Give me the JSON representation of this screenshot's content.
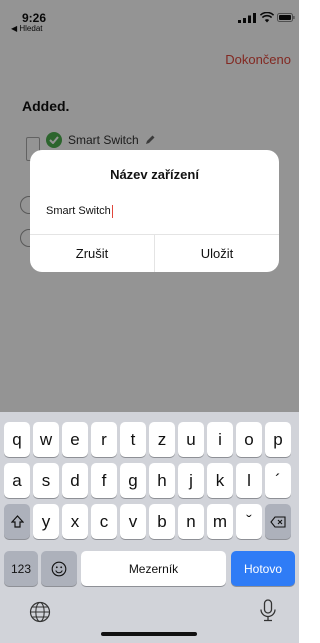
{
  "status_bar": {
    "time": "9:26",
    "back_app": "◀ Hledat"
  },
  "header": {
    "done_label": "Dokončeno"
  },
  "content": {
    "section_title": "Added.",
    "device_name": "Smart Switch"
  },
  "dialog": {
    "title": "Název zařízení",
    "input_value": "Smart Switch",
    "cancel_label": "Zrušit",
    "save_label": "Uložit"
  },
  "keyboard": {
    "row1": [
      "q",
      "w",
      "e",
      "r",
      "t",
      "z",
      "u",
      "i",
      "o",
      "p"
    ],
    "row2": [
      "a",
      "s",
      "d",
      "f",
      "g",
      "h",
      "j",
      "k",
      "l",
      "´"
    ],
    "row3": [
      "y",
      "x",
      "c",
      "v",
      "b",
      "n",
      "m",
      "ˇ"
    ],
    "numbers_label": "123",
    "space_label": "Mezerník",
    "return_label": "Hotovo"
  },
  "colors": {
    "accent": "#e0473c",
    "success": "#4cae4f",
    "keyboard_blue": "#2f7cf6"
  }
}
